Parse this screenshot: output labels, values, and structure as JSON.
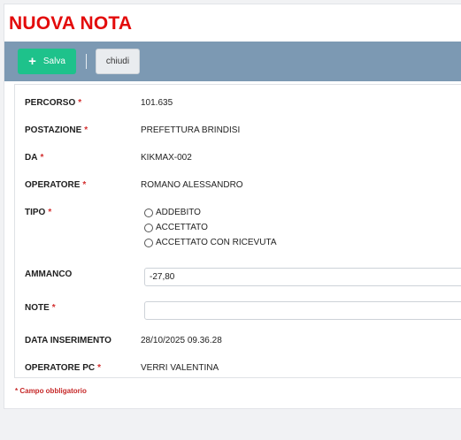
{
  "page": {
    "title": "NUOVA NOTA"
  },
  "toolbar": {
    "save_label": "Salva",
    "save_icon": "+",
    "close_label": "chiudi"
  },
  "form": {
    "required_marker": "*",
    "percorso": {
      "label": "PERCORSO",
      "value": "101.635"
    },
    "postazione": {
      "label": "POSTAZIONE",
      "value": "PREFETTURA BRINDISI"
    },
    "da": {
      "label": "DA",
      "value": "KIKMAX-002"
    },
    "operatore": {
      "label": "OPERATORE",
      "value": "ROMANO ALESSANDRO"
    },
    "tipo": {
      "label": "TIPO",
      "options": [
        "ADDEBITO",
        "ACCETTATO",
        "ACCETTATO CON RICEVUTA"
      ],
      "selected": null
    },
    "ammanco": {
      "label": "AMMANCO",
      "value": "-27,80"
    },
    "note": {
      "label": "NOTE",
      "value": ""
    },
    "data_inserimento": {
      "label": "DATA INSERIMENTO",
      "value": "28/10/2025 09.36.28"
    },
    "operatore_pc": {
      "label": "OPERATORE PC",
      "value": "VERRI VALENTINA"
    }
  },
  "footnote": "* Campo obbligatorio",
  "colors": {
    "title": "#e30b0b",
    "toolbar": "#7c99b3",
    "save_button": "#1ec28b",
    "required": "#d32f2f"
  }
}
